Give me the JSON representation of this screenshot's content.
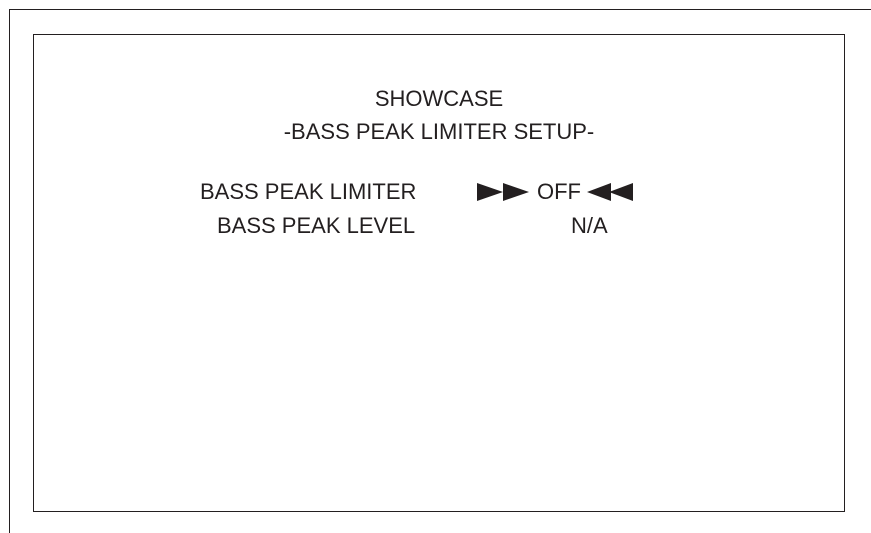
{
  "screen": {
    "title": "SHOWCASE",
    "subtitle": "-BASS PEAK LIMITER SETUP-"
  },
  "settings": [
    {
      "label": "BASS PEAK LIMITER",
      "value": "OFF",
      "selected": true,
      "left_indicator_icon": "double-right-arrow-icon",
      "right_indicator_icon": "double-left-arrow-icon"
    },
    {
      "label": "BASS PEAK LEVEL",
      "value": "N/A",
      "selected": false
    }
  ],
  "colors": {
    "foreground": "#231f20",
    "background": "#ffffff"
  }
}
